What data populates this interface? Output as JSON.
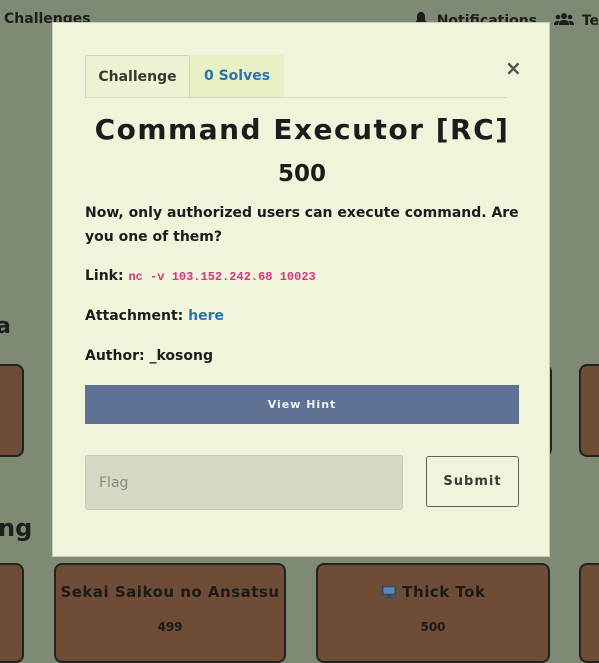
{
  "nav": {
    "left_label": "Challenges",
    "notifications_label": "Notifications",
    "team_label": "Te"
  },
  "background": {
    "section_a_partial": "a",
    "section_b_partial": "ng",
    "cards": [
      {
        "name": "Sekai Saikou no Ansatsu",
        "value": "499"
      },
      {
        "name": "Thick Tok",
        "value": "500",
        "icon": "computer-icon"
      }
    ]
  },
  "modal": {
    "tabs": [
      {
        "label": "Challenge"
      },
      {
        "label": "0 Solves"
      }
    ],
    "close_glyph": "×",
    "title": "Command Executor [RC]",
    "points": "500",
    "description": "Now, only authorized users can execute command. Are you one of them?",
    "link_label": "Link:",
    "link_value": "nc -v 103.152.242.68 10023",
    "attachment_label": "Attachment:",
    "attachment_link": "here",
    "author_label": "Author:",
    "author_value": "_kosong",
    "hint_button": "View Hint",
    "flag_placeholder": "Flag",
    "submit_button": "Submit"
  },
  "colors": {
    "backdrop": "#7f8a74",
    "modal_bg": "#f0f4da",
    "card_bg": "#6e4c35",
    "hint_button": "#5e7293",
    "link_code": "#d63384",
    "link": "#2b72ae"
  }
}
